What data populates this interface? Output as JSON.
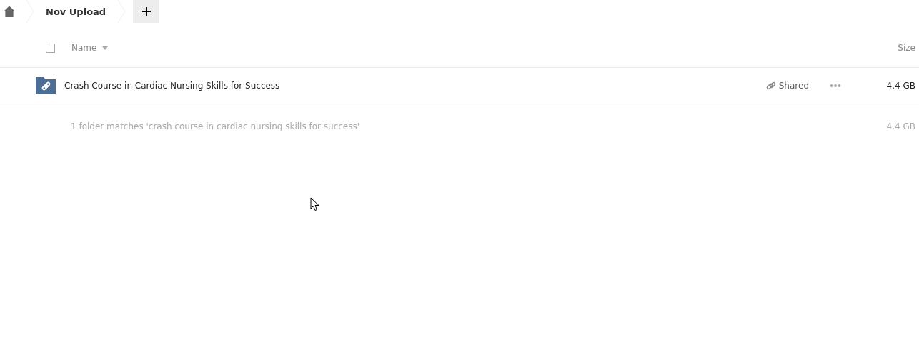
{
  "breadcrumb": {
    "items": [
      {
        "kind": "home"
      },
      {
        "kind": "folder",
        "label": "Nov Upload"
      }
    ]
  },
  "table": {
    "columns": [
      {
        "label": "Name",
        "sortable": true
      },
      {
        "label": "Size"
      }
    ],
    "select_all": {
      "checked": false
    },
    "rows": [
      {
        "name": "Crash Course in Cardiac Nursing Skills for Success",
        "shared_label": "Shared",
        "size": "4.4 GB"
      }
    ],
    "summary": {
      "text": "1 folder matches 'crash course in cardiac nursing skills for success'",
      "size": "4.4 GB"
    }
  }
}
